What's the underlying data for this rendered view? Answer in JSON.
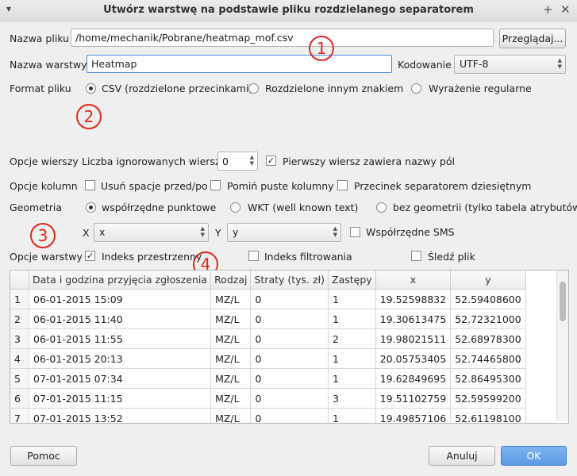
{
  "window": {
    "title": "Utwórz warstwę na podstawie pliku rozdzielanego separatorem"
  },
  "file": {
    "label": "Nazwa pliku",
    "value": "/home/mechanik/Pobrane/heatmap_mof.csv",
    "browse": "Przeglądaj..."
  },
  "layer": {
    "label": "Nazwa warstwy",
    "value": "Heatmap",
    "encoding_label": "Kodowanie",
    "encoding": "UTF-8"
  },
  "format": {
    "label": "Format pliku",
    "options": [
      "CSV (rozdzielone przecinkami)",
      "Rozdzielone innym znakiem",
      "Wyrażenie regularne"
    ]
  },
  "row_options": {
    "label": "Opcje wierszy",
    "skip_label": "Liczba ignorowanych wierszy",
    "skip_value": "0",
    "header_label": "Pierwszy wiersz zawiera nazwy pól"
  },
  "col_options": {
    "label": "Opcje kolumn",
    "trim": "Usuń spacje przed/po",
    "skip_empty": "Pomiń puste kolumny",
    "decimal_comma": "Przecinek separatorem dziesiętnym"
  },
  "geometry": {
    "label": "Geometria",
    "options": [
      "współrzędne punktowe",
      "WKT (well known text)",
      "bez geometrii (tylko tabela atrybutów)"
    ],
    "x_label": "X",
    "x_value": "x",
    "y_label": "Y",
    "y_value": "y",
    "dms": "Współrzędne SMS"
  },
  "layer_options": {
    "label": "Opcje warstwy",
    "spatial_index": "Indeks przestrzenny",
    "filter_index": "Indeks filtrowania",
    "watch": "Śledź plik"
  },
  "badges": [
    "1",
    "2",
    "3",
    "4"
  ],
  "table": {
    "headers": [
      "Data i godzina przyjęcia zgłoszenia",
      "Rodzaj",
      "Straty (tys. zł)",
      "Zastępy",
      "x",
      "y"
    ],
    "rows": [
      {
        "n": "1",
        "c": [
          "06-01-2015 15:09",
          "MZ/L",
          "0",
          "1",
          "19.52598832",
          "52.59408600"
        ]
      },
      {
        "n": "2",
        "c": [
          "06-01-2015 11:40",
          "MZ/L",
          "0",
          "1",
          "19.30613475",
          "52.72321000"
        ]
      },
      {
        "n": "3",
        "c": [
          "06-01-2015 11:55",
          "MZ/L",
          "0",
          "2",
          "19.98021511",
          "52.68978300"
        ]
      },
      {
        "n": "4",
        "c": [
          "06-01-2015 20:13",
          "MZ/L",
          "0",
          "1",
          "20.05753405",
          "52.74465800"
        ]
      },
      {
        "n": "5",
        "c": [
          "07-01-2015 07:34",
          "MZ/L",
          "0",
          "1",
          "19.62849695",
          "52.86495300"
        ]
      },
      {
        "n": "6",
        "c": [
          "07-01-2015 11:15",
          "MZ/L",
          "0",
          "3",
          "19.51102759",
          "52.59599200"
        ]
      },
      {
        "n": "7",
        "c": [
          "07-01-2015 13:52",
          "MZ/L",
          "0",
          "1",
          "19.49857106",
          "52.61198100"
        ]
      }
    ]
  },
  "buttons": {
    "help": "Pomoc",
    "cancel": "Anuluj",
    "ok": "OK"
  }
}
